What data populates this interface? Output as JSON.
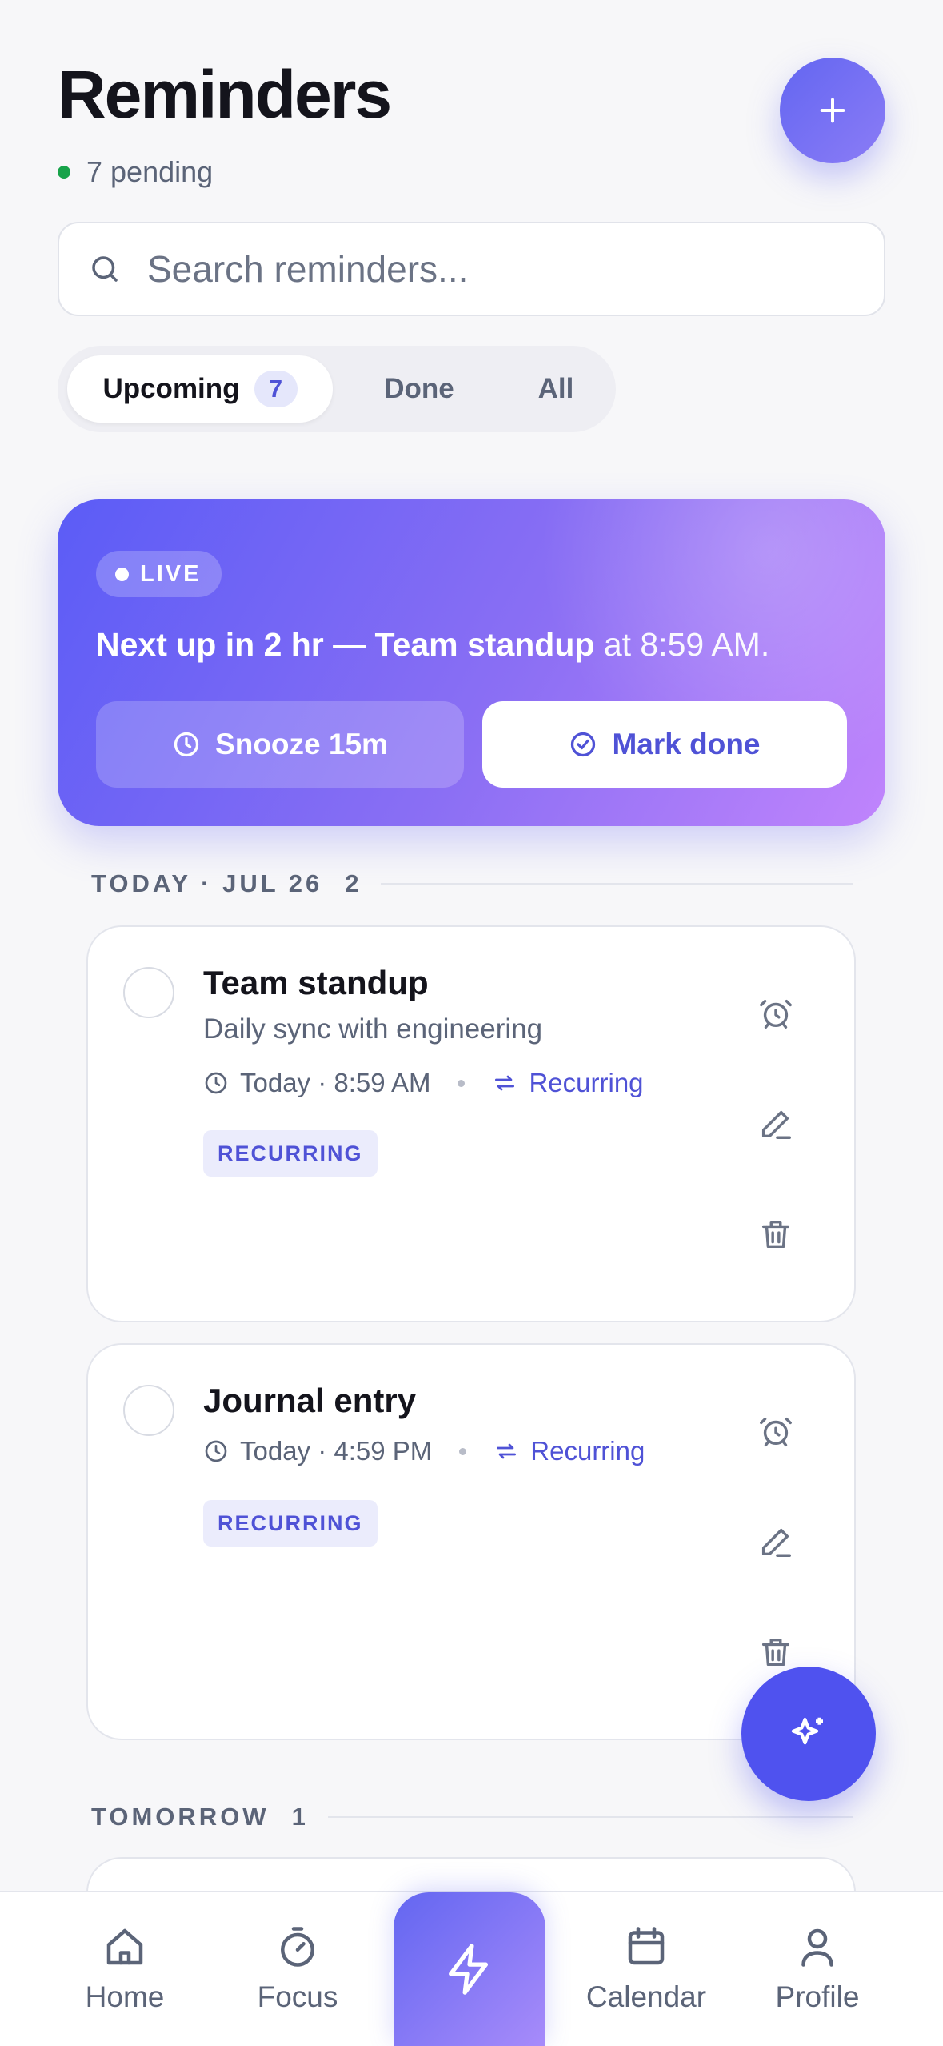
{
  "header": {
    "title": "Reminders",
    "pending_text": "7 pending"
  },
  "search": {
    "placeholder": "Search reminders..."
  },
  "tabs": [
    {
      "label": "Upcoming",
      "count": "7"
    },
    {
      "label": "Done"
    },
    {
      "label": "All"
    }
  ],
  "hero": {
    "badge": "LIVE",
    "text_bold": "Next up in 2 hr — Team standup",
    "text_time": " at 8:59 AM.",
    "snooze_label": "Snooze 15m",
    "done_label": "Mark done"
  },
  "sections": [
    {
      "label": "TODAY · JUL 26",
      "count": "2"
    },
    {
      "label": "TOMORROW",
      "count": "1"
    }
  ],
  "reminders": [
    {
      "title": "Team standup",
      "subtitle": "Daily sync with engineering",
      "time": "Today · 8:59 AM",
      "repeat": "Recurring",
      "tag": "RECURRING"
    },
    {
      "title": "Journal entry",
      "time": "Today · 4:59 PM",
      "repeat": "Recurring",
      "tag": "RECURRING"
    }
  ],
  "nav": [
    {
      "label": "Home",
      "icon": "home-icon"
    },
    {
      "label": "Focus",
      "icon": "timer-icon"
    },
    {
      "label": "",
      "icon": "bolt-icon"
    },
    {
      "label": "Calendar",
      "icon": "calendar-icon"
    },
    {
      "label": "Profile",
      "icon": "user-icon"
    }
  ],
  "colors": {
    "accent": "#4f52ef",
    "gradient_start": "#5b5cf6",
    "gradient_end": "#c084fc",
    "status_green": "#17a34a"
  }
}
